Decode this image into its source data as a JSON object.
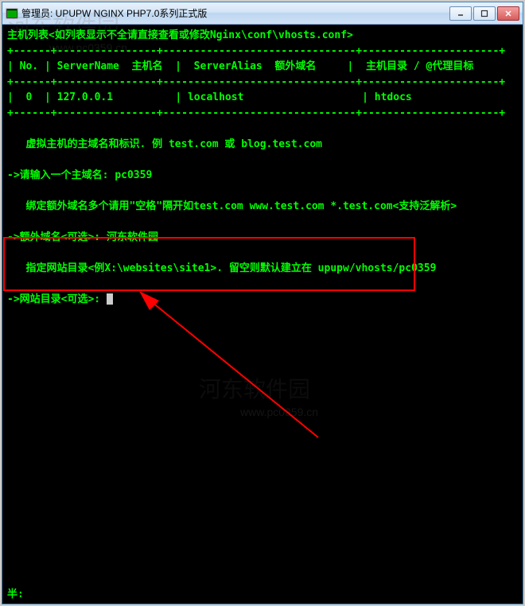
{
  "titlebar": {
    "title": "管理员:  UPUPW NGINX PHP7.0系列正式版"
  },
  "terminal": {
    "line1_a": "主机列表<如列表显示不全请直接查看或修改",
    "line1_b": "Nginx\\conf\\vhosts.conf>",
    "sep": "+------+----------------+-------------------------------+----------------------+",
    "header": "| No. | ServerName  主机名  |  ServerAlias  额外域名     |  主机目录 / @代理目标",
    "row0": "|  0  | 127.0.0.1          | localhost                   | htdocs",
    "line2": "   虚拟主机的主域名和标识. 例 test.com 或 blog.test.com",
    "prompt1_label": "->请输入一个主域名: ",
    "prompt1_value": "pc0359",
    "line3_a": "   绑定额外域名多个请用\"空格\"隔开如",
    "line3_b": "test.com www.test.com *.test.com",
    "line3_c": "<支持泛解析>",
    "prompt2_label": "->额外域名<可选>: ",
    "prompt2_value": "河东软件园",
    "line4_a": "   指定网站目录<例",
    "line4_b": "X:\\websites\\site1>",
    "line4_c": ". 留空则默认建立在 upupw/vhosts/pc0359",
    "prompt3_label": "->网站目录<可选>: ",
    "bottom": "半:"
  },
  "watermark": {
    "text": "河东软件园",
    "url": "www.pc0359.cn"
  },
  "window_controls": {
    "minimize": "minimize",
    "maximize": "maximize",
    "close": "close"
  }
}
